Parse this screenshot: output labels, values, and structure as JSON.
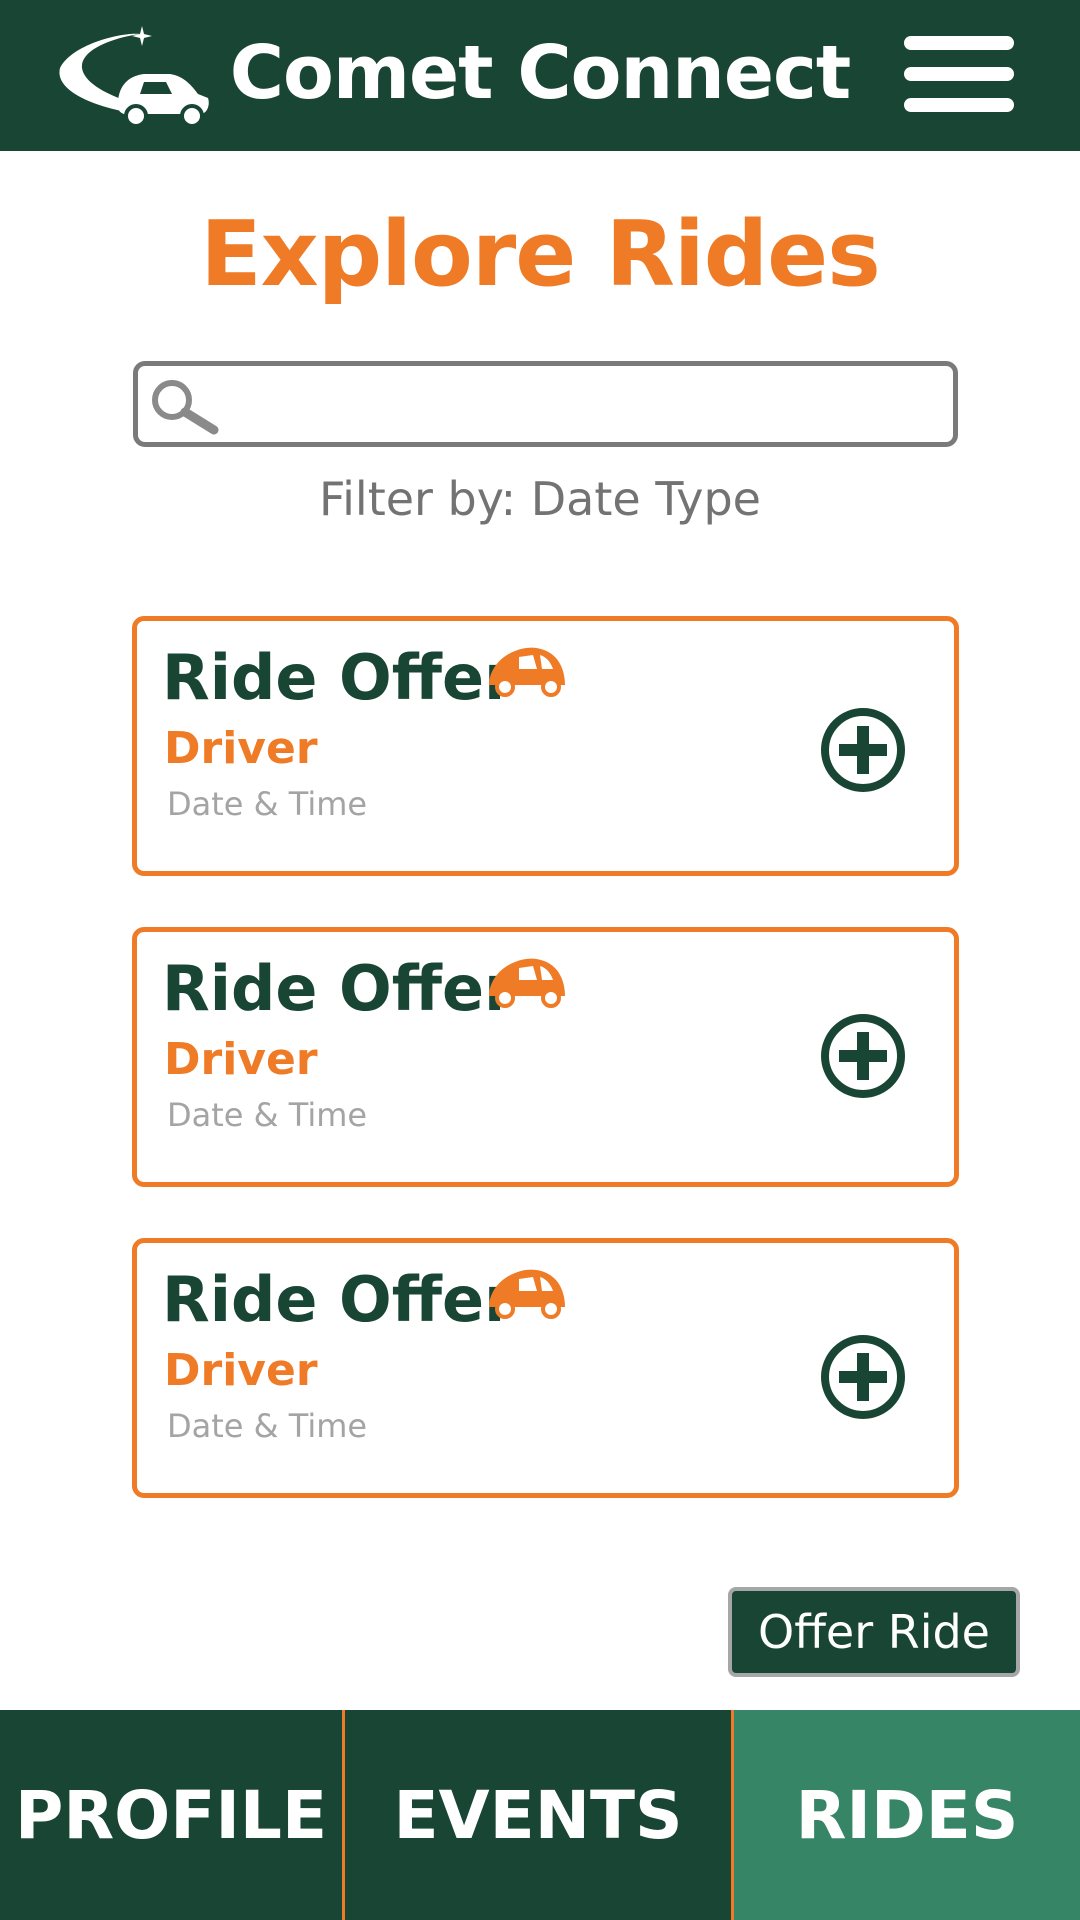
{
  "header": {
    "app_title": "Comet Connect",
    "logo_icon": "comet-car-logo",
    "menu_icon": "hamburger-menu-icon"
  },
  "page": {
    "title": "Explore Rides"
  },
  "search": {
    "placeholder": "",
    "value": ""
  },
  "filter": {
    "label": "Filter by: Date Type"
  },
  "rides": [
    {
      "title": "Ride Offer",
      "driver": "Driver",
      "datetime": "Date & Time"
    },
    {
      "title": "Ride Offer",
      "driver": "Driver",
      "datetime": "Date & Time"
    },
    {
      "title": "Ride Offer",
      "driver": "Driver",
      "datetime": "Date & Time"
    }
  ],
  "actions": {
    "offer_ride_label": "Offer Ride"
  },
  "tabs": {
    "profile": "PROFILE",
    "events": "EVENTS",
    "rides": "RIDES",
    "active": "rides"
  },
  "colors": {
    "brand_green": "#194535",
    "active_tab_green": "#378567",
    "accent_orange": "#ef7b26",
    "muted_gray": "#737373"
  }
}
